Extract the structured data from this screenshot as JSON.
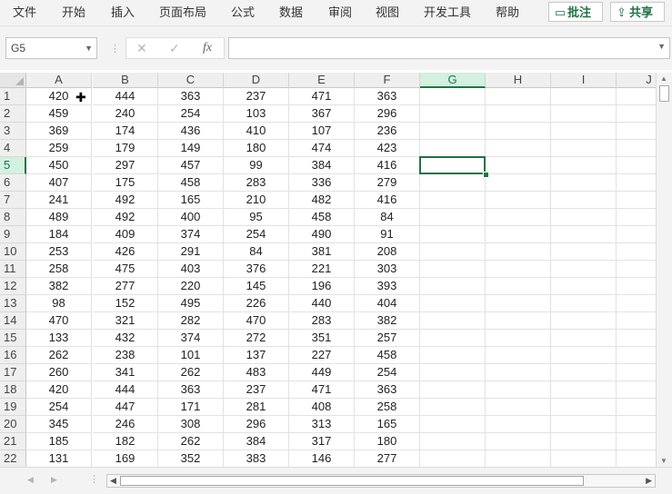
{
  "menu": [
    "文件",
    "开始",
    "插入",
    "页面布局",
    "公式",
    "数据",
    "审阅",
    "视图",
    "开发工具",
    "帮助"
  ],
  "ribbon_buttons": {
    "comments": "批注",
    "share": "共享"
  },
  "name_box": "G5",
  "formula_value": "",
  "columns": [
    "A",
    "B",
    "C",
    "D",
    "E",
    "F",
    "G",
    "H",
    "I",
    "J"
  ],
  "selected_column": "G",
  "selected_row": "5",
  "rows": [
    {
      "n": "1",
      "v": [
        "420",
        "444",
        "363",
        "237",
        "471",
        "363"
      ]
    },
    {
      "n": "2",
      "v": [
        "459",
        "240",
        "254",
        "103",
        "367",
        "296"
      ]
    },
    {
      "n": "3",
      "v": [
        "369",
        "174",
        "436",
        "410",
        "107",
        "236"
      ]
    },
    {
      "n": "4",
      "v": [
        "259",
        "179",
        "149",
        "180",
        "474",
        "423"
      ]
    },
    {
      "n": "5",
      "v": [
        "450",
        "297",
        "457",
        "99",
        "384",
        "416"
      ]
    },
    {
      "n": "6",
      "v": [
        "407",
        "175",
        "458",
        "283",
        "336",
        "279"
      ]
    },
    {
      "n": "7",
      "v": [
        "241",
        "492",
        "165",
        "210",
        "482",
        "416"
      ]
    },
    {
      "n": "8",
      "v": [
        "489",
        "492",
        "400",
        "95",
        "458",
        "84"
      ]
    },
    {
      "n": "9",
      "v": [
        "184",
        "409",
        "374",
        "254",
        "490",
        "91"
      ]
    },
    {
      "n": "10",
      "v": [
        "253",
        "426",
        "291",
        "84",
        "381",
        "208"
      ]
    },
    {
      "n": "11",
      "v": [
        "258",
        "475",
        "403",
        "376",
        "221",
        "303"
      ]
    },
    {
      "n": "12",
      "v": [
        "382",
        "277",
        "220",
        "145",
        "196",
        "393"
      ]
    },
    {
      "n": "13",
      "v": [
        "98",
        "152",
        "495",
        "226",
        "440",
        "404"
      ]
    },
    {
      "n": "14",
      "v": [
        "470",
        "321",
        "282",
        "470",
        "283",
        "382"
      ]
    },
    {
      "n": "15",
      "v": [
        "133",
        "432",
        "374",
        "272",
        "351",
        "257"
      ]
    },
    {
      "n": "16",
      "v": [
        "262",
        "238",
        "101",
        "137",
        "227",
        "458"
      ]
    },
    {
      "n": "17",
      "v": [
        "260",
        "341",
        "262",
        "483",
        "449",
        "254"
      ]
    },
    {
      "n": "18",
      "v": [
        "420",
        "444",
        "363",
        "237",
        "471",
        "363"
      ]
    },
    {
      "n": "19",
      "v": [
        "254",
        "447",
        "171",
        "281",
        "408",
        "258"
      ]
    },
    {
      "n": "20",
      "v": [
        "345",
        "246",
        "308",
        "296",
        "313",
        "165"
      ]
    },
    {
      "n": "21",
      "v": [
        "185",
        "182",
        "262",
        "384",
        "317",
        "180"
      ]
    },
    {
      "n": "22",
      "v": [
        "131",
        "169",
        "352",
        "383",
        "146",
        "277"
      ]
    }
  ],
  "colors": {
    "accent": "#217346",
    "header_bg": "#efefef",
    "selected_header_bg": "#d3f0e0"
  }
}
